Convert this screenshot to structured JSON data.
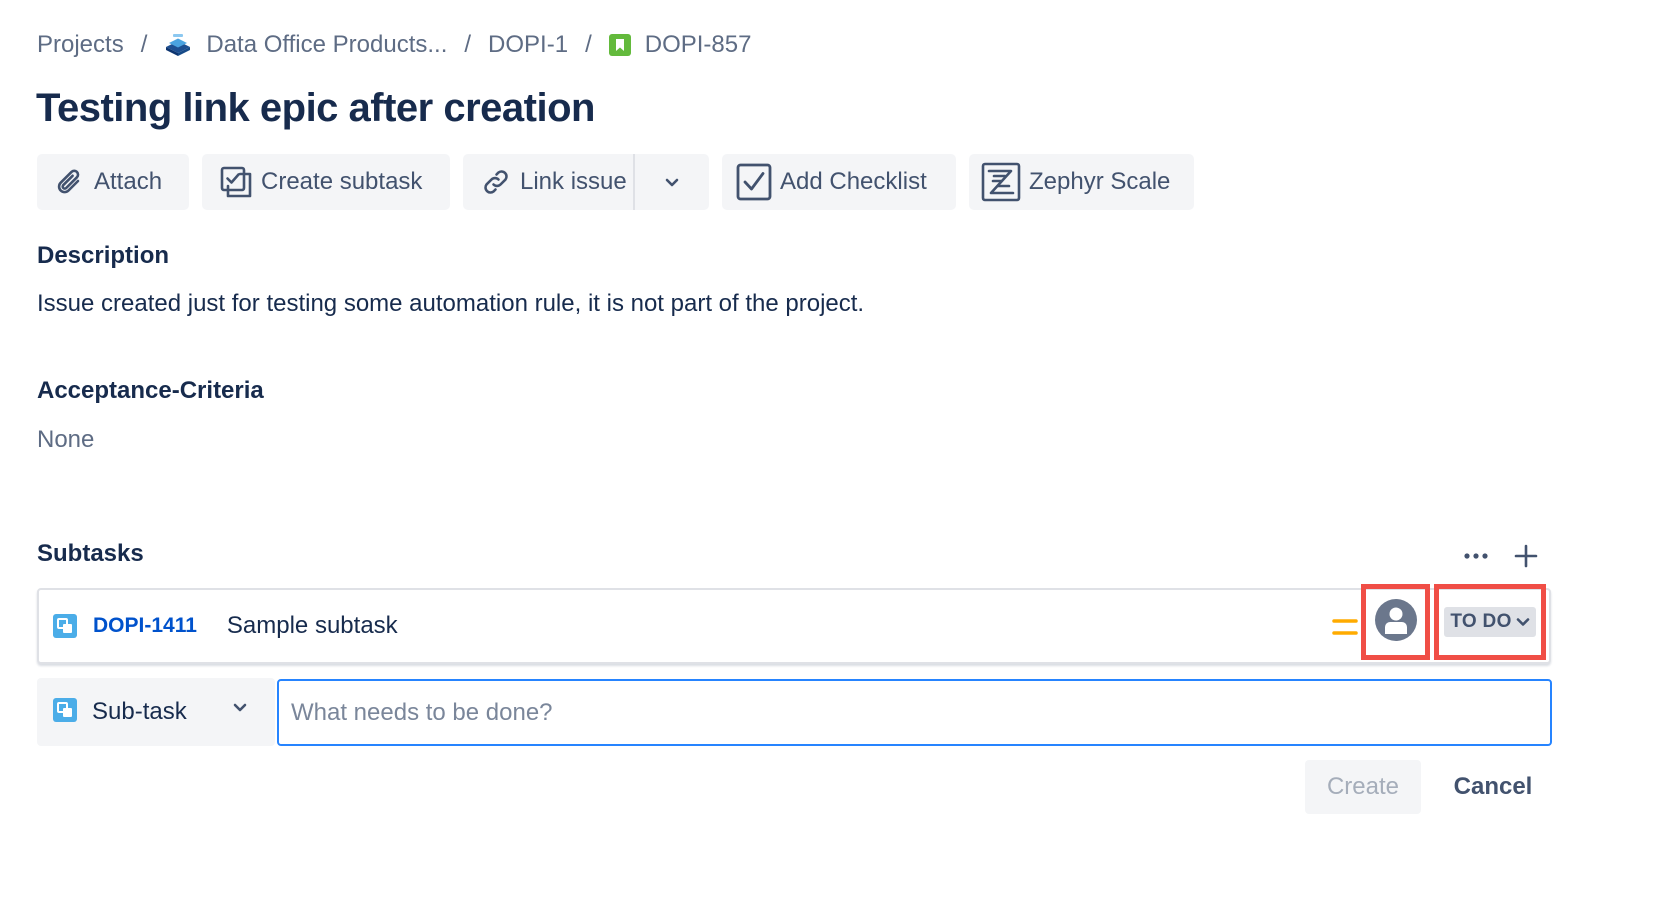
{
  "breadcrumb": {
    "projects": "Projects",
    "project": "Data Office Products...",
    "parent": "DOPI-1",
    "issue": "DOPI-857",
    "separator": "/"
  },
  "issue": {
    "title": "Testing link epic after creation"
  },
  "toolbar": {
    "attach": "Attach",
    "create_subtask": "Create subtask",
    "link_issue": "Link issue",
    "add_checklist": "Add Checklist",
    "zephyr_scale": "Zephyr Scale"
  },
  "description": {
    "label": "Description",
    "text": "Issue created just for testing some automation rule, it is not part of the project."
  },
  "acceptance_criteria": {
    "label": "Acceptance-Criteria",
    "value": "None"
  },
  "subtasks": {
    "label": "Subtasks",
    "items": [
      {
        "key": "DOPI-1411",
        "summary": "Sample subtask",
        "status": "TO DO",
        "priority_icon": "priority-medium-icon",
        "assignee": "unassigned"
      }
    ]
  },
  "create_subtask_form": {
    "type": "Sub-task",
    "placeholder": "What needs to be done?",
    "create": "Create",
    "cancel": "Cancel"
  },
  "colors": {
    "link": "#0052cc",
    "highlight": "#f04e46",
    "story": "#63ba3c",
    "subtask": "#4bade8",
    "priority_medium": "#ffab00",
    "focus": "#2684ff"
  }
}
